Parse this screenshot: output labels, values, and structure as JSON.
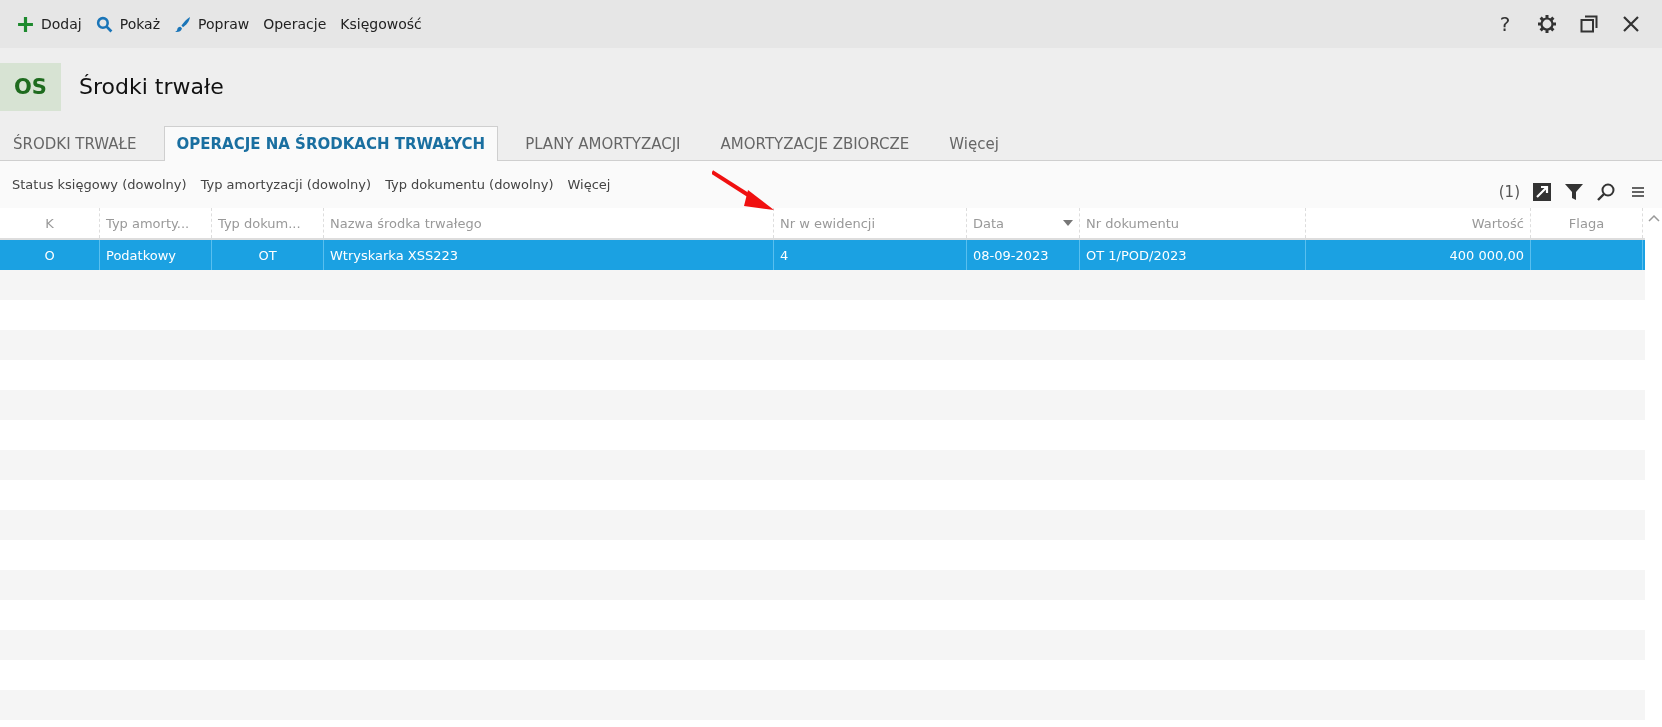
{
  "toolbar": {
    "actions": [
      {
        "kind": "add",
        "label": "Dodaj"
      },
      {
        "kind": "show",
        "label": "Pokaż"
      },
      {
        "kind": "edit",
        "label": "Popraw"
      },
      {
        "kind": "plain",
        "label": "Operacje"
      },
      {
        "kind": "plain",
        "label": "Księgowość"
      }
    ],
    "window_controls": [
      {
        "kind": "help",
        "label": "?"
      },
      {
        "kind": "settings"
      },
      {
        "kind": "restore"
      },
      {
        "kind": "close"
      }
    ]
  },
  "header": {
    "badge": "OS",
    "title": "Środki trwałe"
  },
  "tabs": [
    {
      "label": "ŚRODKI TRWAŁE",
      "selected": false
    },
    {
      "label": "OPERACJE NA ŚRODKACH TRWAŁYCH",
      "selected": true
    },
    {
      "label": "PLANY AMORTYZACJI",
      "selected": false
    },
    {
      "label": "AMORTYZACJE ZBIORCZE",
      "selected": false
    },
    {
      "label": "Więcej",
      "selected": false
    }
  ],
  "filters": [
    "Status księgowy (dowolny)",
    "Typ amortyzacji (dowolny)",
    "Typ dokumentu (dowolny)",
    "Więcej"
  ],
  "filter_tools": {
    "count": "(1)"
  },
  "table": {
    "columns": [
      {
        "label": "K",
        "sorted": false
      },
      {
        "label": "Typ amorty...",
        "sorted": false
      },
      {
        "label": "Typ dokum...",
        "sorted": false
      },
      {
        "label": "Nazwa środka trwałego",
        "sorted": false
      },
      {
        "label": "Nr w ewidencji",
        "sorted": false
      },
      {
        "label": "Data",
        "sorted": true
      },
      {
        "label": "Nr dokumentu",
        "sorted": false
      },
      {
        "label": "Wartość",
        "sorted": false
      },
      {
        "label": "Flaga",
        "sorted": false
      }
    ],
    "rows": [
      {
        "selected": true,
        "cells": [
          "O",
          "Podatkowy",
          "OT",
          "Wtryskarka XSS223",
          "4",
          "08-09-2023",
          "OT 1/POD/2023",
          "400 000,00",
          ""
        ]
      }
    ]
  }
}
